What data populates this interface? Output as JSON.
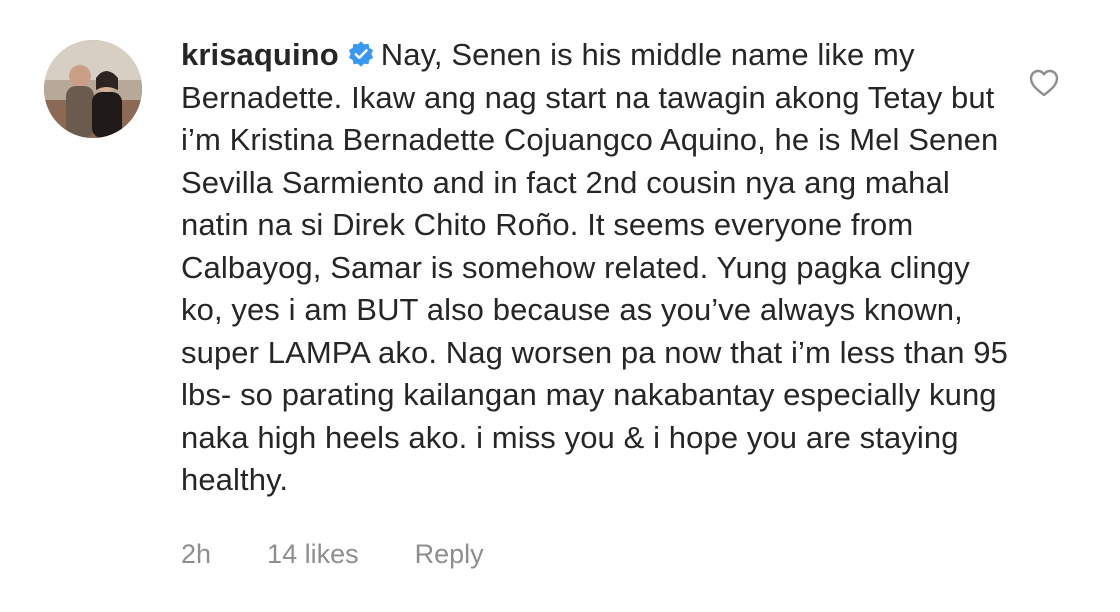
{
  "comment": {
    "username": "krisaquino",
    "verified_icon": "verified-badge-icon",
    "message": "Nay, Senen is his middle name like my Bernadette. Ikaw ang nag start na tawagin akong Tetay but i’m Kristina Bernadette Cojuangco Aquino, he is Mel Senen Sevilla Sarmiento and in fact 2nd cousin nya ang mahal natin na si Direk Chito Roño. It seems everyone from Calbayog, Samar is somehow related. Yung pagka clingy ko, yes i am BUT also because as you’ve always known, super LAMPA ako. Nag worsen pa now that i’m less than 95 lbs- so parating kailangan may nakabantay especially kung naka high heels ako. i miss you & i hope you are staying healthy.",
    "time": "2h",
    "likes": "14 likes",
    "reply": "Reply",
    "like_icon": "heart-outline-icon"
  },
  "colors": {
    "text": "#262626",
    "meta": "#8e8e8e",
    "verified": "#3897f0",
    "heart": "#8e8e8e"
  }
}
